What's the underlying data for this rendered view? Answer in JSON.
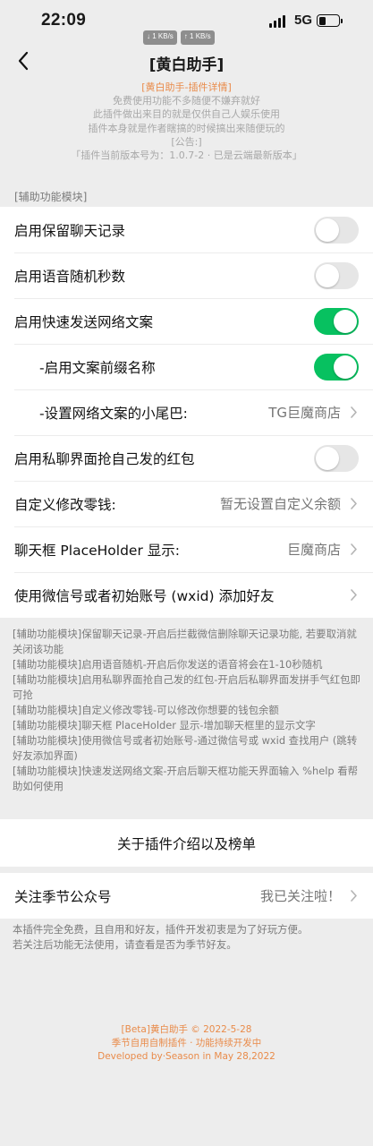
{
  "status_bar": {
    "time": "22:09",
    "download_speed": "↓ 1 KB/s",
    "upload_speed": "↑ 1 KB/s",
    "network": "5G"
  },
  "nav": {
    "title": "[黄白助手]"
  },
  "header_info": {
    "line_accent": "[黄白助手-插件详情]",
    "lines": [
      "免费使用功能不多随便不嫌弃就好",
      "此插件做出来目的就是仅供自己人娱乐使用",
      "插件本身就是作者瞎搞的时候搞出来随便玩的",
      "[公告:]",
      "「插件当前版本号为：1.0.7-2 · 已是云端最新版本」"
    ]
  },
  "section_label": "[辅助功能模块]",
  "settings": [
    {
      "label": "启用保留聊天记录",
      "type": "toggle",
      "on": false
    },
    {
      "label": "启用语音随机秒数",
      "type": "toggle",
      "on": false
    },
    {
      "label": "启用快速发送网络文案",
      "type": "toggle",
      "on": true
    },
    {
      "label": "-启用文案前缀名称",
      "type": "toggle",
      "on": true,
      "indent": true
    },
    {
      "label": "-设置网络文案的小尾巴:",
      "type": "link",
      "value": "TG巨魔商店",
      "indent": true
    },
    {
      "label": "启用私聊界面抢自己发的红包",
      "type": "toggle",
      "on": false
    },
    {
      "label": "自定义修改零钱:",
      "type": "link",
      "value": "暂无设置自定义余额"
    },
    {
      "label": "聊天框 PlaceHolder 显示:",
      "type": "link",
      "value": "巨魔商店"
    },
    {
      "label": "使用微信号或者初始账号 (wxid) 添加好友",
      "type": "link",
      "value": ""
    }
  ],
  "descriptions": [
    "[辅助功能模块]保留聊天记录-开启后拦截微信删除聊天记录功能, 若要取消就关闭该功能",
    "[辅助功能模块]启用语音随机-开启后你发送的语音将会在1-10秒随机",
    "[辅助功能模块]启用私聊界面抢自己发的红包-开启后私聊界面发拼手气红包即可抢",
    "[辅助功能模块]自定义修改零钱-可以修改你想要的钱包余额",
    "[辅助功能模块]聊天框 PlaceHolder 显示-增加聊天框里的显示文字",
    "[辅助功能模块]使用微信号或者初始账号-通过微信号或 wxid 查找用户 (跳转好友添加界面)",
    "[辅助功能模块]快速发送网络文案-开启后聊天框功能天界面输入 %help 看帮助如何使用"
  ],
  "about_button": "关于插件介绍以及榜单",
  "follow_row": {
    "label": "关注季节公众号",
    "value": "我已关注啦！"
  },
  "follow_note": [
    "本插件完全免费，且自用和好友，插件开发初衷是为了好玩方便。",
    "若关注后功能无法使用，请查看是否为季节好友。"
  ],
  "footer": [
    "[Beta]黄白助手 © 2022-5-28",
    "季节自用自制插件 · 功能持续开发中",
    "Developed by·Season in May 28,2022"
  ],
  "colors": {
    "accent": "#e98b4a",
    "toggle_on": "#07c160",
    "toggle_off": "#e6e6e6",
    "background": "#ededed"
  }
}
